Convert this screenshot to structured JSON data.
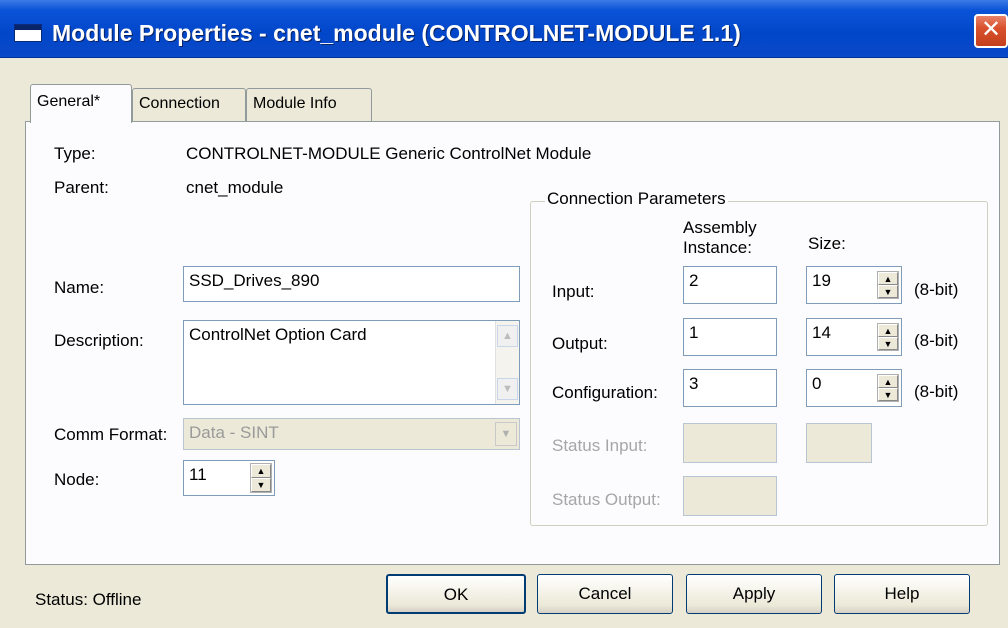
{
  "window": {
    "title": "Module Properties - cnet_module (CONTROLNET-MODULE 1.1)",
    "close_glyph": "✕"
  },
  "tabs": [
    {
      "label": "General*"
    },
    {
      "label": "Connection"
    },
    {
      "label": "Module Info"
    }
  ],
  "general": {
    "type_label": "Type:",
    "type_value": "CONTROLNET-MODULE Generic ControlNet Module",
    "parent_label": "Parent:",
    "parent_value": "cnet_module",
    "name_label": "Name:",
    "name_value": "SSD_Drives_890",
    "description_label": "Description:",
    "description_value": "ControlNet Option Card",
    "comm_format_label": "Comm Format:",
    "comm_format_value": "Data - SINT",
    "node_label": "Node:",
    "node_value": "11"
  },
  "connection_parameters": {
    "legend": "Connection Parameters",
    "assembly_header_1": "Assembly",
    "assembly_header_2": "Instance:",
    "size_header": "Size:",
    "rows": [
      {
        "label": "Input:",
        "instance": "2",
        "size": "19",
        "unit": "(8-bit)"
      },
      {
        "label": "Output:",
        "instance": "1",
        "size": "14",
        "unit": "(8-bit)"
      },
      {
        "label": "Configuration:",
        "instance": "3",
        "size": "0",
        "unit": "(8-bit)"
      },
      {
        "label": "Status Input:",
        "instance": "",
        "size": ""
      },
      {
        "label": "Status Output:",
        "instance": ""
      }
    ]
  },
  "status": {
    "text": "Status:  Offline"
  },
  "buttons": {
    "ok": "OK",
    "cancel": "Cancel",
    "apply": "Apply",
    "help": "Help"
  }
}
